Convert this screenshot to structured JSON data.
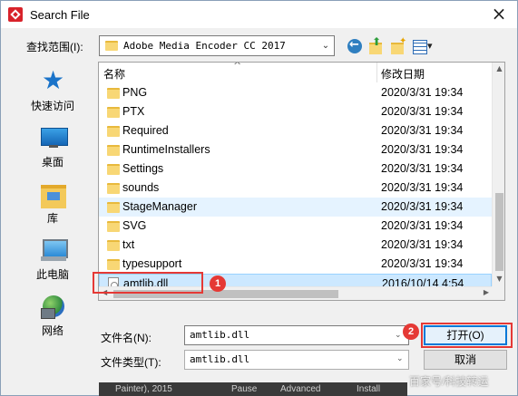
{
  "window": {
    "title": "Search File",
    "close_glyph": "×"
  },
  "lookin": {
    "label": "查找范围(I):",
    "value": "Adobe Media Encoder CC 2017",
    "arrow": "⌄"
  },
  "places": [
    {
      "label": "快速访问",
      "icon": "quick-access-icon"
    },
    {
      "label": "桌面",
      "icon": "desktop-icon"
    },
    {
      "label": "库",
      "icon": "library-icon"
    },
    {
      "label": "此电脑",
      "icon": "this-pc-icon"
    },
    {
      "label": "网络",
      "icon": "network-icon"
    }
  ],
  "filelist": {
    "columns": {
      "name": "名称",
      "date": "修改日期",
      "sort_glyph": "^"
    },
    "rows": [
      {
        "name": "PNG",
        "date": "2020/3/31 19:34",
        "type": "folder"
      },
      {
        "name": "PTX",
        "date": "2020/3/31 19:34",
        "type": "folder"
      },
      {
        "name": "Required",
        "date": "2020/3/31 19:34",
        "type": "folder"
      },
      {
        "name": "RuntimeInstallers",
        "date": "2020/3/31 19:34",
        "type": "folder"
      },
      {
        "name": "Settings",
        "date": "2020/3/31 19:34",
        "type": "folder"
      },
      {
        "name": "sounds",
        "date": "2020/3/31 19:34",
        "type": "folder"
      },
      {
        "name": "StageManager",
        "date": "2020/3/31 19:34",
        "type": "folder"
      },
      {
        "name": "SVG",
        "date": "2020/3/31 19:34",
        "type": "folder"
      },
      {
        "name": "txt",
        "date": "2020/3/31 19:34",
        "type": "folder"
      },
      {
        "name": "typesupport",
        "date": "2020/3/31 19:34",
        "type": "folder"
      },
      {
        "name": "amtlib.dll",
        "date": "2016/10/14 4:54",
        "type": "dll"
      }
    ],
    "hovered_row": "StageManager",
    "selected_row": "amtlib.dll"
  },
  "filename": {
    "label": "文件名(N):",
    "value": "amtlib.dll",
    "arrow": "⌄"
  },
  "filetype": {
    "label": "文件类型(T):",
    "value": "amtlib.dll",
    "arrow": "⌄"
  },
  "buttons": {
    "open": "打开(O)",
    "cancel": "取消"
  },
  "annotations": {
    "badge1": "1",
    "badge2": "2",
    "color": "#e53935"
  },
  "background": {
    "peek1": "Painter), 2015",
    "peek2": "Pause",
    "peek3": "Advanced",
    "peek4": "Install"
  },
  "watermark": "百家号/科技转运",
  "colors": {
    "selection": "#cce8ff",
    "hover": "#e5f3ff",
    "accent": "#0078d7"
  }
}
